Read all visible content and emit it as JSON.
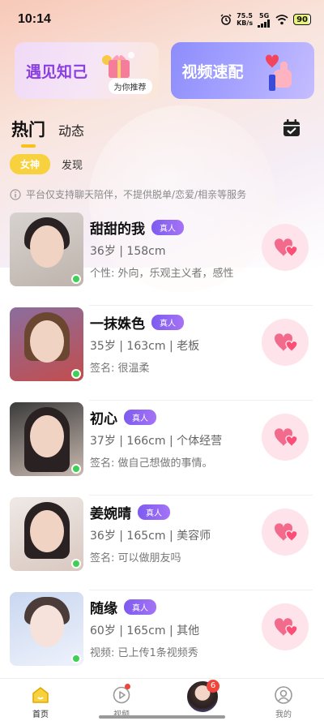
{
  "status_bar": {
    "time": "10:14",
    "net_speed_value": "75.5",
    "net_speed_unit": "KB/s",
    "signal": "5G",
    "battery": "90"
  },
  "banners": [
    {
      "title": "遇见知己",
      "tag": "为你推荐",
      "icon": "gift-box-icon"
    },
    {
      "title": "视频速配",
      "icon": "thumbs-up-heart-icon"
    }
  ],
  "tabs": [
    {
      "label": "热门",
      "active": true
    },
    {
      "label": "动态",
      "active": false
    }
  ],
  "subtabs": [
    {
      "label": "女神",
      "active": true
    },
    {
      "label": "发现",
      "active": false
    }
  ],
  "notice": "平台仅支持聊天陪伴，不提供脱单/恋爱/相亲等服务",
  "users": [
    {
      "name": "甜甜的我",
      "badge": "真人",
      "meta": "36岁 | 158cm",
      "desc": "个性: 外向，乐观主义者，感性",
      "online": true
    },
    {
      "name": "一抹姝色",
      "badge": "真人",
      "meta": "35岁 | 163cm | 老板",
      "desc": "签名: 很温柔",
      "online": true
    },
    {
      "name": "初心",
      "badge": "真人",
      "meta": "37岁 | 166cm | 个体经营",
      "desc": "签名: 做自己想做的事情。",
      "online": true
    },
    {
      "name": "姜婉晴",
      "badge": "真人",
      "meta": "36岁 | 165cm | 美容师",
      "desc": "签名: 可以做朋友吗",
      "online": true
    },
    {
      "name": "随缘",
      "badge": "真人",
      "meta": "60岁 | 165cm | 其他",
      "desc": "视频: 已上传1条视频秀",
      "online": true
    }
  ],
  "bottom_nav": {
    "items": [
      {
        "label": "首页",
        "icon": "home-icon",
        "active": true
      },
      {
        "label": "视频",
        "icon": "video-play-icon",
        "active": false,
        "dot": true
      },
      {
        "label": "",
        "icon": "avatar",
        "badge": "6"
      },
      {
        "label": "我的",
        "icon": "profile-icon",
        "active": false
      }
    ]
  },
  "colors": {
    "accent_yellow": "#f8d13e",
    "badge_purple": "#8a5cf2",
    "like_pink": "#ffe3ea",
    "heart_pink": "#f36b8c",
    "online_green": "#3fcf55"
  }
}
